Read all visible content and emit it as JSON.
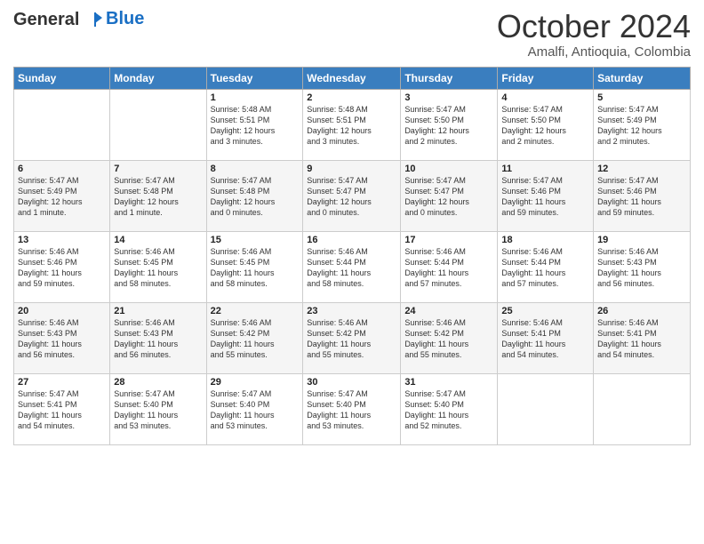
{
  "header": {
    "logo_line1": "General",
    "logo_line2": "Blue",
    "month": "October 2024",
    "location": "Amalfi, Antioquia, Colombia"
  },
  "weekdays": [
    "Sunday",
    "Monday",
    "Tuesday",
    "Wednesday",
    "Thursday",
    "Friday",
    "Saturday"
  ],
  "weeks": [
    [
      {
        "day": "",
        "info": ""
      },
      {
        "day": "",
        "info": ""
      },
      {
        "day": "1",
        "info": "Sunrise: 5:48 AM\nSunset: 5:51 PM\nDaylight: 12 hours\nand 3 minutes."
      },
      {
        "day": "2",
        "info": "Sunrise: 5:48 AM\nSunset: 5:51 PM\nDaylight: 12 hours\nand 3 minutes."
      },
      {
        "day": "3",
        "info": "Sunrise: 5:47 AM\nSunset: 5:50 PM\nDaylight: 12 hours\nand 2 minutes."
      },
      {
        "day": "4",
        "info": "Sunrise: 5:47 AM\nSunset: 5:50 PM\nDaylight: 12 hours\nand 2 minutes."
      },
      {
        "day": "5",
        "info": "Sunrise: 5:47 AM\nSunset: 5:49 PM\nDaylight: 12 hours\nand 2 minutes."
      }
    ],
    [
      {
        "day": "6",
        "info": "Sunrise: 5:47 AM\nSunset: 5:49 PM\nDaylight: 12 hours\nand 1 minute."
      },
      {
        "day": "7",
        "info": "Sunrise: 5:47 AM\nSunset: 5:48 PM\nDaylight: 12 hours\nand 1 minute."
      },
      {
        "day": "8",
        "info": "Sunrise: 5:47 AM\nSunset: 5:48 PM\nDaylight: 12 hours\nand 0 minutes."
      },
      {
        "day": "9",
        "info": "Sunrise: 5:47 AM\nSunset: 5:47 PM\nDaylight: 12 hours\nand 0 minutes."
      },
      {
        "day": "10",
        "info": "Sunrise: 5:47 AM\nSunset: 5:47 PM\nDaylight: 12 hours\nand 0 minutes."
      },
      {
        "day": "11",
        "info": "Sunrise: 5:47 AM\nSunset: 5:46 PM\nDaylight: 11 hours\nand 59 minutes."
      },
      {
        "day": "12",
        "info": "Sunrise: 5:47 AM\nSunset: 5:46 PM\nDaylight: 11 hours\nand 59 minutes."
      }
    ],
    [
      {
        "day": "13",
        "info": "Sunrise: 5:46 AM\nSunset: 5:46 PM\nDaylight: 11 hours\nand 59 minutes."
      },
      {
        "day": "14",
        "info": "Sunrise: 5:46 AM\nSunset: 5:45 PM\nDaylight: 11 hours\nand 58 minutes."
      },
      {
        "day": "15",
        "info": "Sunrise: 5:46 AM\nSunset: 5:45 PM\nDaylight: 11 hours\nand 58 minutes."
      },
      {
        "day": "16",
        "info": "Sunrise: 5:46 AM\nSunset: 5:44 PM\nDaylight: 11 hours\nand 58 minutes."
      },
      {
        "day": "17",
        "info": "Sunrise: 5:46 AM\nSunset: 5:44 PM\nDaylight: 11 hours\nand 57 minutes."
      },
      {
        "day": "18",
        "info": "Sunrise: 5:46 AM\nSunset: 5:44 PM\nDaylight: 11 hours\nand 57 minutes."
      },
      {
        "day": "19",
        "info": "Sunrise: 5:46 AM\nSunset: 5:43 PM\nDaylight: 11 hours\nand 56 minutes."
      }
    ],
    [
      {
        "day": "20",
        "info": "Sunrise: 5:46 AM\nSunset: 5:43 PM\nDaylight: 11 hours\nand 56 minutes."
      },
      {
        "day": "21",
        "info": "Sunrise: 5:46 AM\nSunset: 5:43 PM\nDaylight: 11 hours\nand 56 minutes."
      },
      {
        "day": "22",
        "info": "Sunrise: 5:46 AM\nSunset: 5:42 PM\nDaylight: 11 hours\nand 55 minutes."
      },
      {
        "day": "23",
        "info": "Sunrise: 5:46 AM\nSunset: 5:42 PM\nDaylight: 11 hours\nand 55 minutes."
      },
      {
        "day": "24",
        "info": "Sunrise: 5:46 AM\nSunset: 5:42 PM\nDaylight: 11 hours\nand 55 minutes."
      },
      {
        "day": "25",
        "info": "Sunrise: 5:46 AM\nSunset: 5:41 PM\nDaylight: 11 hours\nand 54 minutes."
      },
      {
        "day": "26",
        "info": "Sunrise: 5:46 AM\nSunset: 5:41 PM\nDaylight: 11 hours\nand 54 minutes."
      }
    ],
    [
      {
        "day": "27",
        "info": "Sunrise: 5:47 AM\nSunset: 5:41 PM\nDaylight: 11 hours\nand 54 minutes."
      },
      {
        "day": "28",
        "info": "Sunrise: 5:47 AM\nSunset: 5:40 PM\nDaylight: 11 hours\nand 53 minutes."
      },
      {
        "day": "29",
        "info": "Sunrise: 5:47 AM\nSunset: 5:40 PM\nDaylight: 11 hours\nand 53 minutes."
      },
      {
        "day": "30",
        "info": "Sunrise: 5:47 AM\nSunset: 5:40 PM\nDaylight: 11 hours\nand 53 minutes."
      },
      {
        "day": "31",
        "info": "Sunrise: 5:47 AM\nSunset: 5:40 PM\nDaylight: 11 hours\nand 52 minutes."
      },
      {
        "day": "",
        "info": ""
      },
      {
        "day": "",
        "info": ""
      }
    ]
  ]
}
